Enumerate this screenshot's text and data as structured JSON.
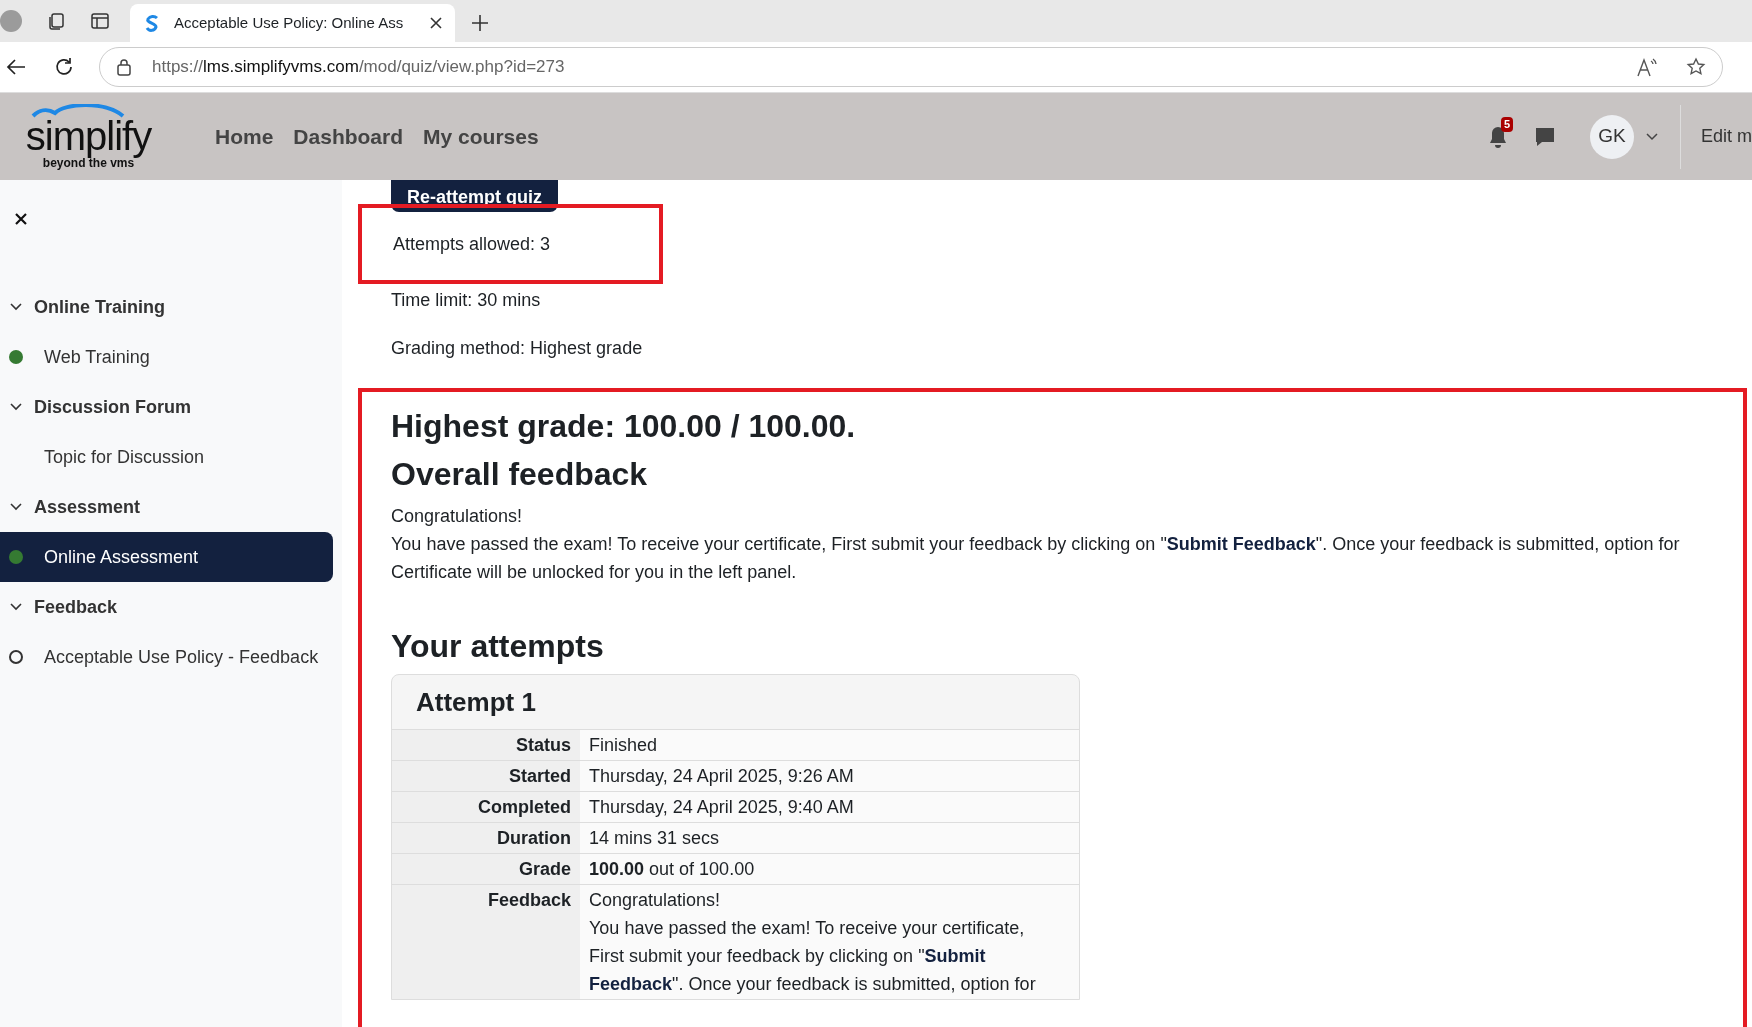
{
  "browser": {
    "tab_title": "Acceptable Use Policy: Online Ass",
    "url_host": "lms.simplifyvms.com",
    "url_scheme": "https://",
    "url_path": "/mod/quiz/view.php?id=273"
  },
  "header": {
    "logo_text": "simplify",
    "logo_tagline": "beyond the vms",
    "nav": [
      "Home",
      "Dashboard",
      "My courses"
    ],
    "notification_count": "5",
    "avatar_initials": "GK",
    "edit_mode_label": "Edit m"
  },
  "sidebar": {
    "sections": [
      {
        "title": "Online Training",
        "expanded": true,
        "children": [
          {
            "label": "Web Training",
            "kind": "done",
            "selected": false
          }
        ]
      },
      {
        "title": "Discussion Forum",
        "expanded": true,
        "children": [
          {
            "label": "Topic for Discussion",
            "kind": "none",
            "selected": false
          }
        ]
      },
      {
        "title": "Assessment",
        "expanded": true,
        "children": [
          {
            "label": "Online Assessment",
            "kind": "done",
            "selected": true
          }
        ]
      },
      {
        "title": "Feedback",
        "expanded": true,
        "children": [
          {
            "label": "Acceptable Use Policy - Feedback",
            "kind": "todo",
            "selected": false
          }
        ]
      }
    ]
  },
  "quiz": {
    "reattempt_button": "Re-attempt quiz",
    "info": [
      "Attempts allowed: 3",
      "Time limit: 30 mins",
      "Grading method: Highest grade"
    ],
    "highest_grade": "Highest grade: 100.00 / 100.00.",
    "overall_feedback_title": "Overall feedback",
    "overall_feedback": [
      "Congratulations!",
      "You have passed the exam! To receive your certificate, First submit your feedback by clicking on \"**Submit Feedback**\". Once your feedback is submitted, option for Certificate will be unlocked for you in the left panel."
    ],
    "attempts_title": "Your attempts",
    "attempt": {
      "title": "Attempt 1",
      "rows": [
        {
          "label": "Status",
          "value": "Finished"
        },
        {
          "label": "Started",
          "value": "Thursday, 24 April 2025, 9:26 AM"
        },
        {
          "label": "Completed",
          "value": "Thursday, 24 April 2025, 9:40 AM"
        },
        {
          "label": "Duration",
          "value": "14 mins 31 secs"
        },
        {
          "label": "Grade",
          "value": "**100.00** out of 100.00"
        },
        {
          "label": "Feedback",
          "value": "Congratulations!",
          "extra": "You have passed the exam! To receive your certificate, First submit your feedback by clicking on \"**Submit Feedback**\". Once your feedback is submitted, option for"
        }
      ]
    }
  }
}
